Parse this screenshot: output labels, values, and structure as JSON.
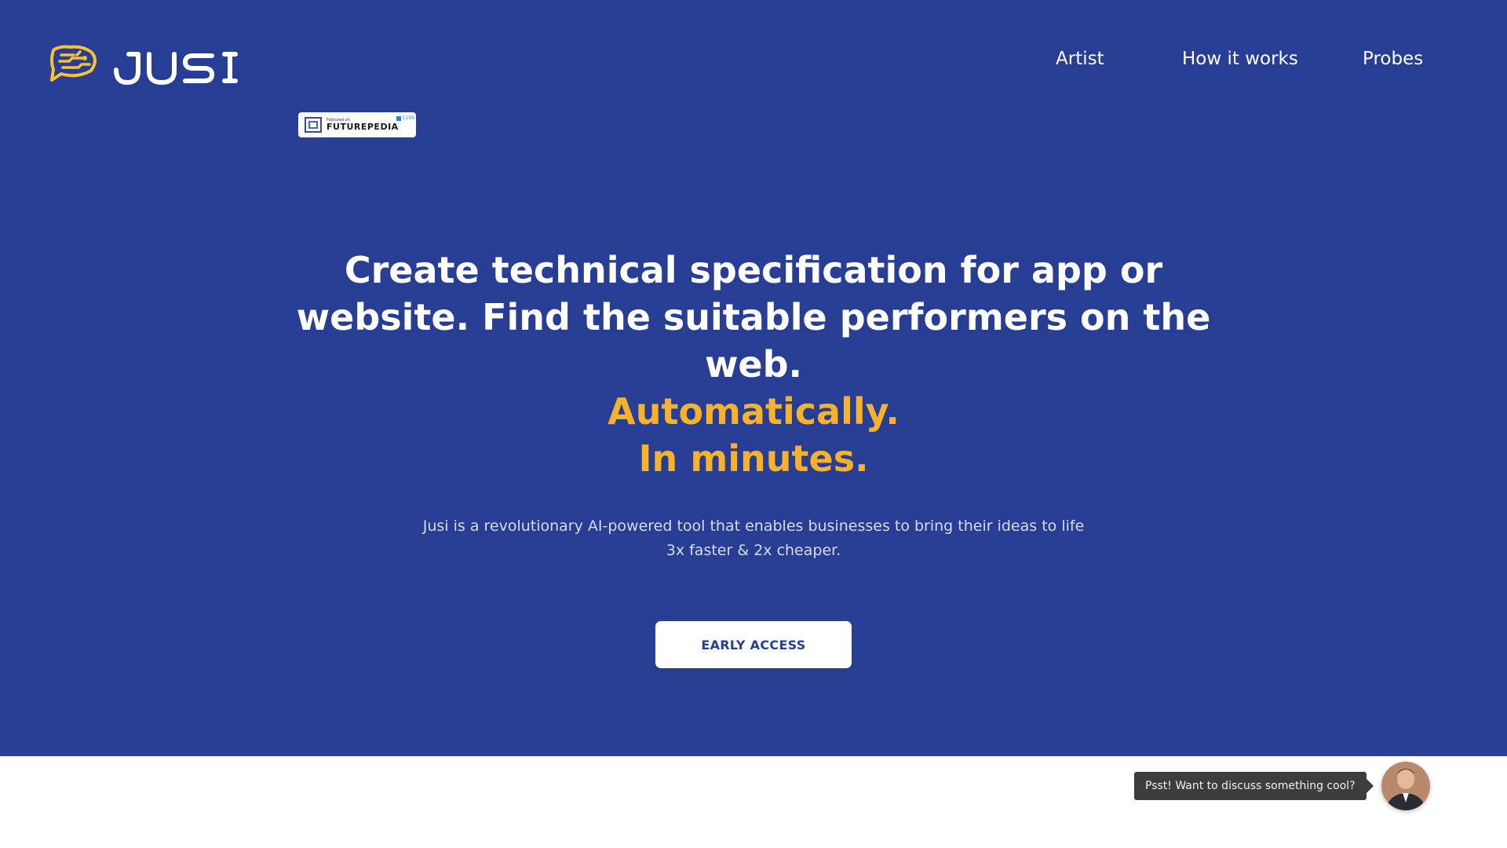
{
  "brand": {
    "name": "JUSI",
    "logo_icon": "brain-speech-bubble-icon",
    "logo_color": "#f6c431"
  },
  "nav": {
    "items": [
      {
        "label": "Artist"
      },
      {
        "label": "How it works"
      },
      {
        "label": "Probes"
      }
    ]
  },
  "badge": {
    "featured_on": "Featured on",
    "name": "FUTUREPEDIA",
    "corner_text": "1159"
  },
  "hero": {
    "headline": "Create technical specification for app or website. Find the suitable performers on the web.",
    "accent_line_1": "Automatically.",
    "accent_line_2": "In minutes.",
    "subtitle_line_1": "Jusi is a revolutionary AI-powered tool that enables businesses to bring their ideas to life",
    "subtitle_line_2": "3x faster & 2x cheaper.",
    "cta_label": "EARLY ACCESS"
  },
  "chat": {
    "message": "Psst! Want to discuss something cool?"
  },
  "colors": {
    "hero_background": "#283d94",
    "accent": "#f6b22a",
    "text_primary": "#ffffff",
    "page_background": "#ffffff"
  }
}
